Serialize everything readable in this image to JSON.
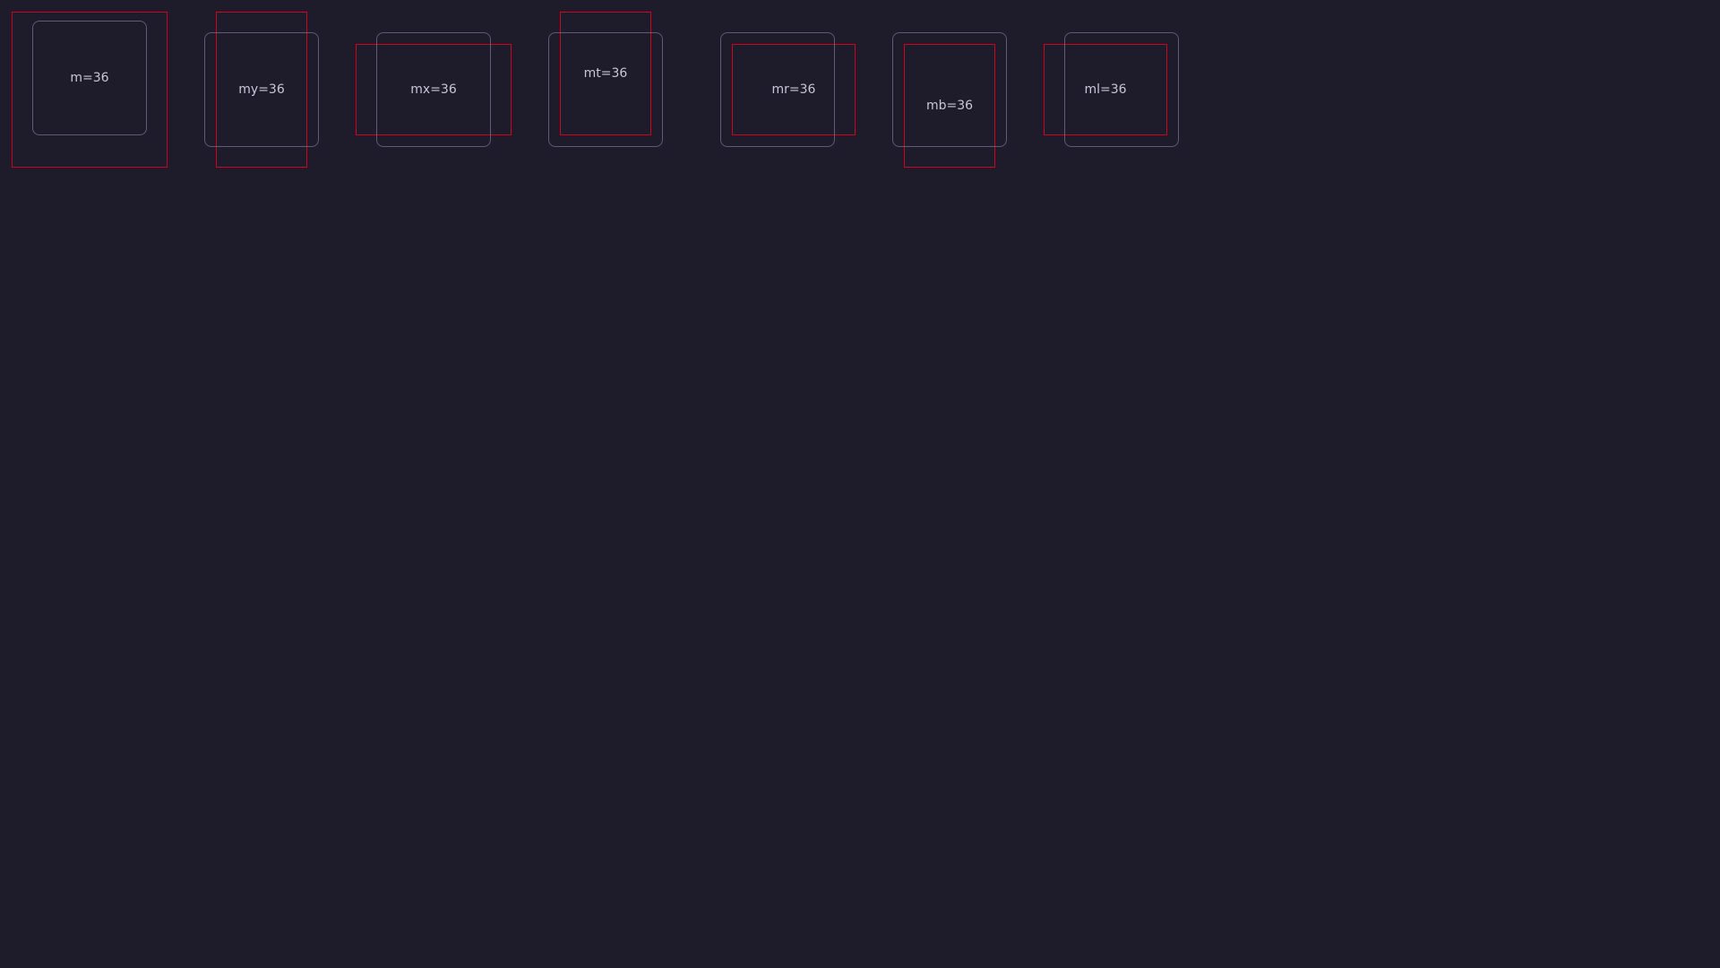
{
  "demos": {
    "m": {
      "label": "m=36"
    },
    "my": {
      "label": "my=36"
    },
    "mx": {
      "label": "mx=36"
    },
    "mt": {
      "label": "mt=36"
    },
    "mr": {
      "label": "mr=36"
    },
    "mb": {
      "label": "mb=36"
    },
    "ml": {
      "label": "ml=36"
    }
  },
  "colors": {
    "background": "#1e1c2b",
    "box_border": "#5f5d70",
    "margin_outline": "#d1001f",
    "label_text": "#c9c7d6"
  }
}
